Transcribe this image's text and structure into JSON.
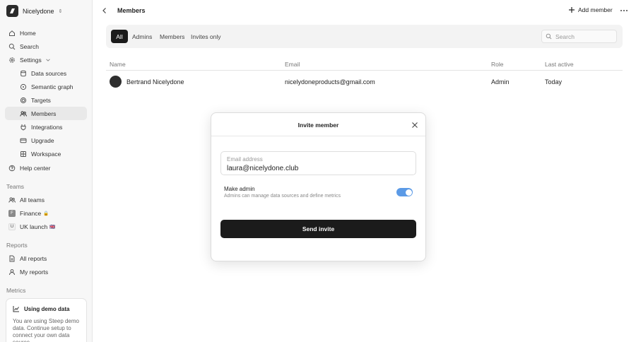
{
  "workspace": {
    "name": "Nicelydone",
    "caret": "⌃"
  },
  "sidebar": {
    "main_items": [
      {
        "label": "Home",
        "icon": "home-icon"
      },
      {
        "label": "Search",
        "icon": "search-icon"
      },
      {
        "label": "Settings",
        "icon": "gear-icon"
      }
    ],
    "settings_items": [
      {
        "label": "Data sources",
        "icon": "database-icon"
      },
      {
        "label": "Semantic graph",
        "icon": "graph-icon"
      },
      {
        "label": "Targets",
        "icon": "target-icon"
      },
      {
        "label": "Members",
        "icon": "users-icon",
        "active": true
      },
      {
        "label": "Integrations",
        "icon": "plug-icon"
      },
      {
        "label": "Upgrade",
        "icon": "card-icon"
      },
      {
        "label": "Workspace",
        "icon": "building-icon"
      }
    ],
    "help_label": "Help center",
    "teams_heading": "Teams",
    "teams": [
      {
        "label": "All teams",
        "chip": ""
      },
      {
        "label": "Finance",
        "chip": "F",
        "badge": "🔒"
      },
      {
        "label": "UK launch",
        "chip": "U",
        "badge": "🇬🇧"
      }
    ],
    "reports_heading": "Reports",
    "reports": [
      {
        "label": "All reports"
      },
      {
        "label": "My reports"
      }
    ],
    "metrics_heading": "Metrics",
    "demo_card": {
      "title": "Using demo data",
      "body": "You are using Steep demo data. Continue setup to connect your own data source."
    }
  },
  "header": {
    "title": "Members",
    "add_member_label": "Add member"
  },
  "filters": {
    "tabs": [
      "All",
      "Admins",
      "Members",
      "Invites only"
    ],
    "active_tab": "All",
    "search_placeholder": "Search"
  },
  "table": {
    "columns": [
      "Name",
      "Email",
      "Role",
      "Last active"
    ],
    "rows": [
      {
        "name": "Bertrand Nicelydone",
        "email": "nicelydoneproducts@gmail.com",
        "role": "Admin",
        "last_active": "Today"
      }
    ]
  },
  "modal": {
    "title": "Invite member",
    "email_label": "Email address",
    "email_value": "laura@nicelydone.club",
    "admin_title": "Make admin",
    "admin_desc": "Admins can manage data sources and define metrics",
    "admin_enabled": true,
    "send_label": "Send invite"
  },
  "colors": {
    "accent": "#1b1b1b",
    "toggle_on": "#5b9ae6",
    "sidebar_bg": "#f7f7f7"
  }
}
